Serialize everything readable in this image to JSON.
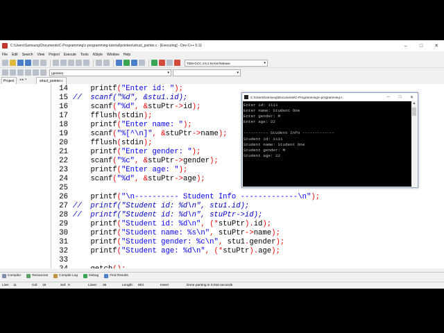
{
  "window": {
    "title": "C:\\Users\\Samsung\\Documents\\C-Programming\\c-programming-tutorial\\pointers\\struct_pointer.c - [Executing] - Dev-C++ 5.11"
  },
  "menu": [
    "File",
    "Edit",
    "Search",
    "View",
    "Project",
    "Execute",
    "Tools",
    "AStyle",
    "Window",
    "Help"
  ],
  "toolbar": {
    "compiler": "TDM-GCC 4.9.2 64-bit Release",
    "scope": "(globals)"
  },
  "tabs": {
    "project": "Project",
    "nav": "◂ ▸ ×",
    "file": "struct_pointer.c"
  },
  "code_lines": [
    {
      "n": "14",
      "t": "    printf(\"Enter id: \");"
    },
    {
      "n": "15",
      "t": "//  scanf(\"%d\", &stu1.id);"
    },
    {
      "n": "16",
      "t": "    scanf(\"%d\", &stuPtr->id);"
    },
    {
      "n": "17",
      "t": "    fflush(stdin);"
    },
    {
      "n": "18",
      "t": "    printf(\"Enter name: \");"
    },
    {
      "n": "19",
      "t": "    scanf(\"%[^\\n]\", &stuPtr->name);"
    },
    {
      "n": "20",
      "t": "    fflush(stdin);"
    },
    {
      "n": "21",
      "t": "    printf(\"Enter gender: \");"
    },
    {
      "n": "22",
      "t": "    scanf(\"%c\", &stuPtr->gender);"
    },
    {
      "n": "23",
      "t": "    printf(\"Enter age: \");"
    },
    {
      "n": "24",
      "t": "    scanf(\"%d\", &stuPtr->age);"
    },
    {
      "n": "25",
      "t": ""
    },
    {
      "n": "26",
      "t": "    printf(\"\\n---------- Student Info -------------\\n\");"
    },
    {
      "n": "27",
      "t": "//  printf(\"Student id: %d\\n\", stu1.id);"
    },
    {
      "n": "28",
      "t": "//  printf(\"Student id: %d\\n\", stuPtr->id);"
    },
    {
      "n": "29",
      "t": "    printf(\"Student id: %d\\n\", (*stuPtr).id);"
    },
    {
      "n": "30",
      "t": "    printf(\"Student name: %s\\n\", stuPtr->name);"
    },
    {
      "n": "31",
      "t": "    printf(\"Student gender: %c\\n\", stu1.gender);"
    },
    {
      "n": "32",
      "t": "    printf(\"Student age: %d\\n\", (*stuPtr).age);"
    },
    {
      "n": "33",
      "t": ""
    },
    {
      "n": "34",
      "t": "    getch();"
    }
  ],
  "console": {
    "title": "C:\\Users\\Samsung\\Documents\\C-Programming\\c-programming-t...",
    "lines": [
      "Enter id: 1111",
      "Enter name: Student One",
      "Enter gender: M",
      "Enter age: 22",
      "",
      "---------- Student Info -------------",
      "Student id: 1111",
      "Student name: Student One",
      "Student gender: M",
      "Student age: 22"
    ]
  },
  "bottom_tabs": [
    "Compiler",
    "Resources",
    "Compile Log",
    "Debug",
    "Find Results"
  ],
  "status": {
    "line": "Line:",
    "line_val": "11",
    "col": "Col:",
    "col_val": "15",
    "sel": "Sel:",
    "sel_val": "0",
    "lines": "Lines:",
    "lines_val": "36",
    "length": "Length:",
    "length_val": "803",
    "mode": "Insert",
    "message": "Done parsing in 0.016 seconds"
  },
  "colors": {
    "string": "#0000ff",
    "comment": "#0000c8",
    "operator": "#ff0000",
    "console_bg": "#000000",
    "console_fg": "#c0c0c0"
  }
}
